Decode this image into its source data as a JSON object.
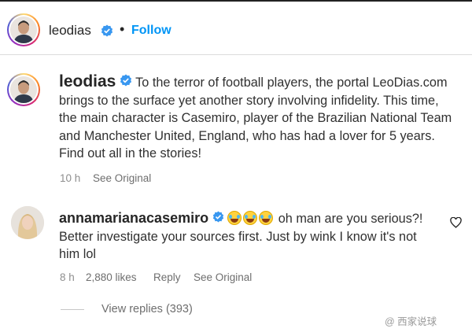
{
  "header": {
    "username": "leodias",
    "dot": "•",
    "follow_label": "Follow"
  },
  "caption": {
    "username": "leodias",
    "text": "To the terror of football players, the portal LeoDias.com brings to the surface yet another story involving infidelity. This time, the main character is Casemiro, player of the Brazilian National Team and Manchester United, England, who has had a lover for 5 years. Find out all in the stories!",
    "time": "10 h",
    "see_original": "See Original"
  },
  "comment": {
    "username": "annamarianacasemiro",
    "emojis": [
      "joy-emoji",
      "joy-emoji",
      "joy-emoji"
    ],
    "text": "oh man are you serious?! Better investigate your sources first. Just by wink I know it's not him lol",
    "time": "8 h",
    "likes": "2,880 likes",
    "reply_label": "Reply",
    "see_original": "See Original",
    "view_replies": "View replies (393)"
  },
  "watermark": {
    "text": "@ 西家说球"
  },
  "colors": {
    "accent": "#0095f6",
    "verified": "#3897f0",
    "muted": "#8e8e8e"
  }
}
